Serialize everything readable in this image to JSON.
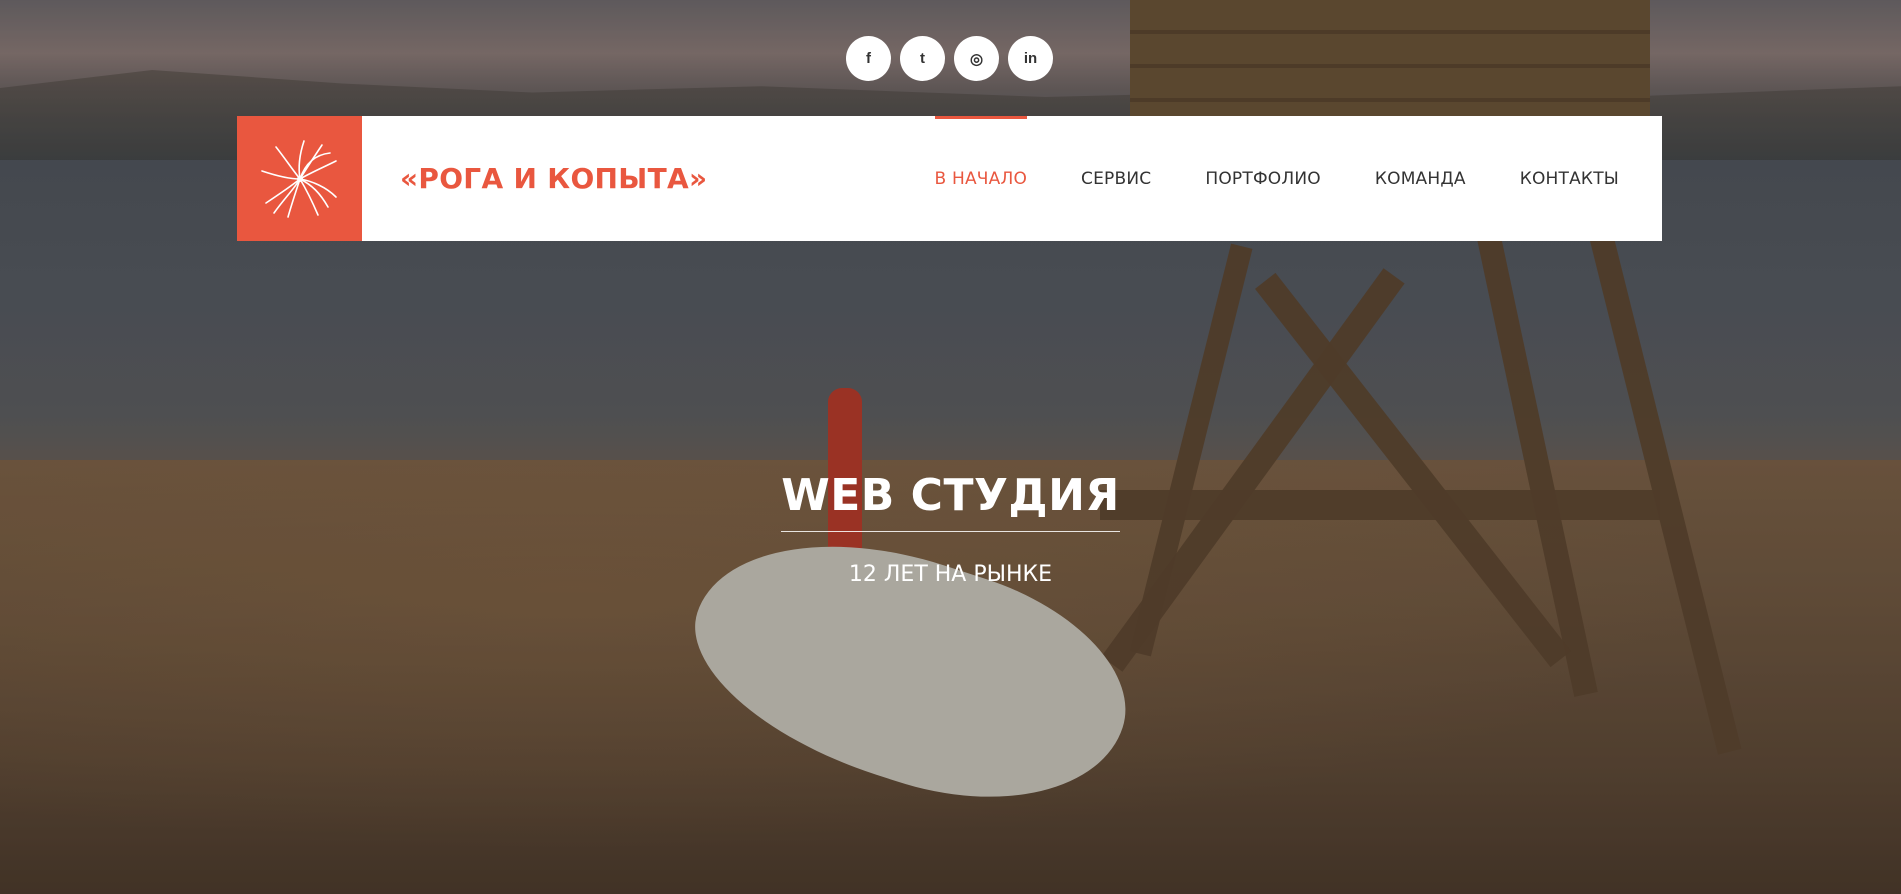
{
  "colors": {
    "accent": "#e9573f",
    "header_bg": "#ffffff",
    "nav_text": "#333333",
    "hero_text": "#ffffff"
  },
  "social": [
    {
      "icon": "facebook-icon",
      "glyph": "f"
    },
    {
      "icon": "twitter-icon",
      "glyph": "t"
    },
    {
      "icon": "dribbble-icon",
      "glyph": "◎"
    },
    {
      "icon": "linkedin-icon",
      "glyph": "in"
    }
  ],
  "header": {
    "logo_icon": "starburst-logo-icon",
    "brand": "«РОГА И КОПЫТА»"
  },
  "nav": [
    {
      "label": "В НАЧАЛО",
      "active": true
    },
    {
      "label": "СЕРВИС",
      "active": false
    },
    {
      "label": "ПОРТФОЛИО",
      "active": false
    },
    {
      "label": "КОМАНДА",
      "active": false
    },
    {
      "label": "КОНТАКТЫ",
      "active": false
    }
  ],
  "hero": {
    "title": "WEB СТУДИЯ",
    "subtitle": "12 ЛЕТ НА РЫНКЕ"
  }
}
